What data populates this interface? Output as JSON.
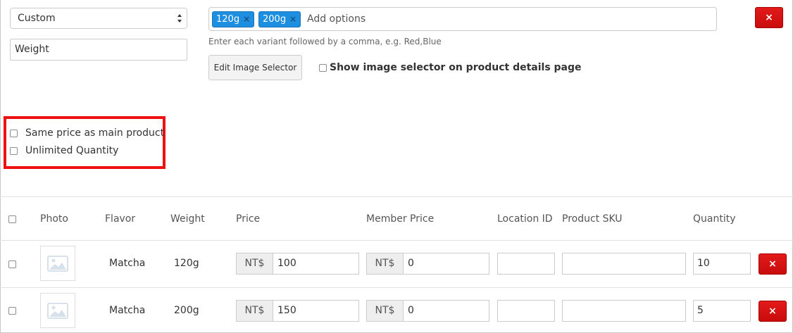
{
  "variant": {
    "type_select": "Custom",
    "name_value": "Weight",
    "tags": [
      {
        "label": "120g",
        "remove": "×"
      },
      {
        "label": "200g",
        "remove": "×"
      }
    ],
    "tag_placeholder": "Add options",
    "help_text": "Enter each variant followed by a comma, e.g. Red,Blue",
    "edit_image_selector": "Edit Image Selector",
    "show_image_selector_label": "Show image selector on product details page",
    "delete_label": "×"
  },
  "options": {
    "same_price": "Same price as main product",
    "unlimited_quantity": "Unlimited Quantity"
  },
  "table": {
    "headers": {
      "photo": "Photo",
      "flavor": "Flavor",
      "weight": "Weight",
      "price": "Price",
      "member_price": "Member Price",
      "location_id": "Location ID",
      "sku": "Product SKU",
      "quantity": "Quantity"
    },
    "currency": "NT$",
    "rows": [
      {
        "flavor": "Matcha",
        "weight": "120g",
        "price": "100",
        "member_price": "0",
        "location_id": "",
        "sku": "",
        "quantity": "10",
        "delete": "×"
      },
      {
        "flavor": "Matcha",
        "weight": "200g",
        "price": "150",
        "member_price": "0",
        "location_id": "",
        "sku": "",
        "quantity": "5",
        "delete": "×"
      }
    ]
  },
  "colors": {
    "tag_blue": "#1e8fe0",
    "danger_red": "#d9140f",
    "highlight_red": "#ee1111"
  }
}
